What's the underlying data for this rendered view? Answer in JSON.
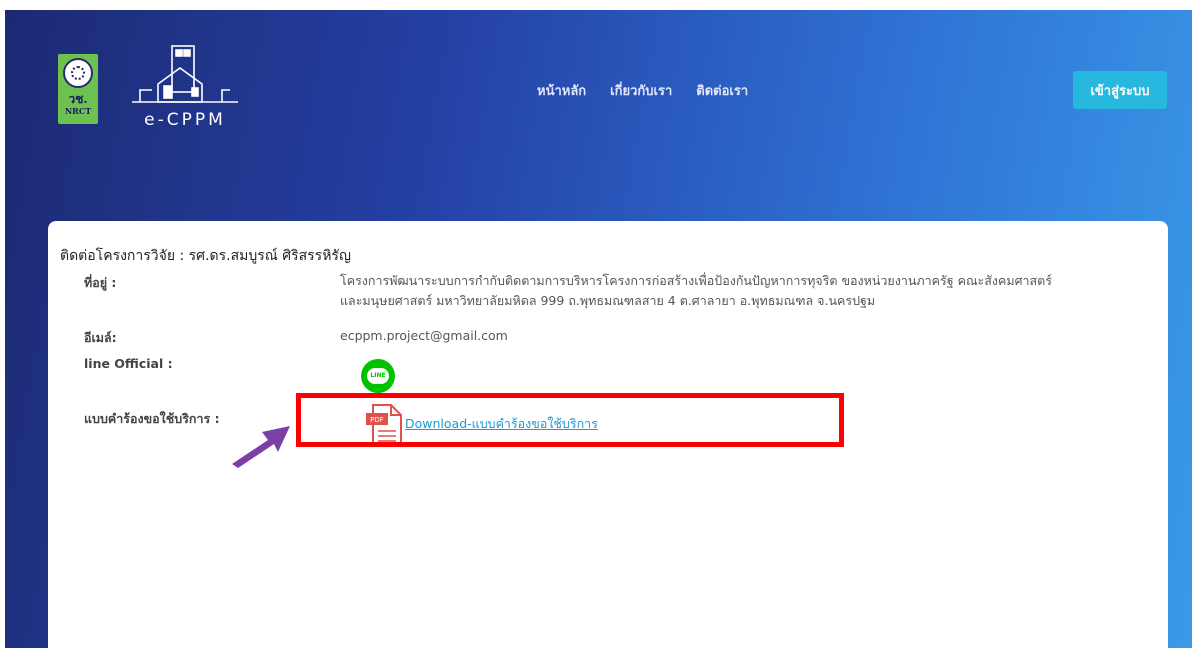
{
  "header": {
    "nrct_logo": {
      "line1": "วช.",
      "line2": "NRCT"
    },
    "brand": "e-CPPM",
    "nav": [
      "หน้าหลัก",
      "เกี่ยวกับเรา",
      "ติดต่อเรา"
    ],
    "login_label": "เข้าสู่ระบบ"
  },
  "contact": {
    "title": "ติดต่อโครงการวิจัย : รศ.ดร.สมบูรณ์ ศิริสรรหิรัญ",
    "address_label": "ที่อยู่ :",
    "address_line1": "โครงการพัฒนาระบบการกำกับติดตามการบริหารโครงการก่อสร้างเพื่อป้องกันปัญหาการทุจริต ของหน่วยงานภาครัฐ คณะสังคมศาสตร์",
    "address_line2": "และมนุษยศาสตร์ มหาวิทยาลัยมหิดล 999 ถ.พุทธมณฑลสาย 4 ต.ศาลายา อ.พุทธมณฑล จ.นครปฐม",
    "email_label": "อีเมล์:",
    "email": "ecppm.project@gmail.com",
    "line_label": "line Official :",
    "line_icon_text": "LINE",
    "form_label": "แบบคำร้องขอใช้บริการ :",
    "download_text": "Download-แบบคำร้องขอใช้บริการ"
  },
  "icons": {
    "pdf": "pdf-file-icon",
    "line": "line-app-icon",
    "arrow": "purple-arrow-icon"
  },
  "colors": {
    "accent": "#27b8e0",
    "highlight": "#ff0000",
    "arrow": "#7b3fa6",
    "link": "#1a9ad6"
  }
}
